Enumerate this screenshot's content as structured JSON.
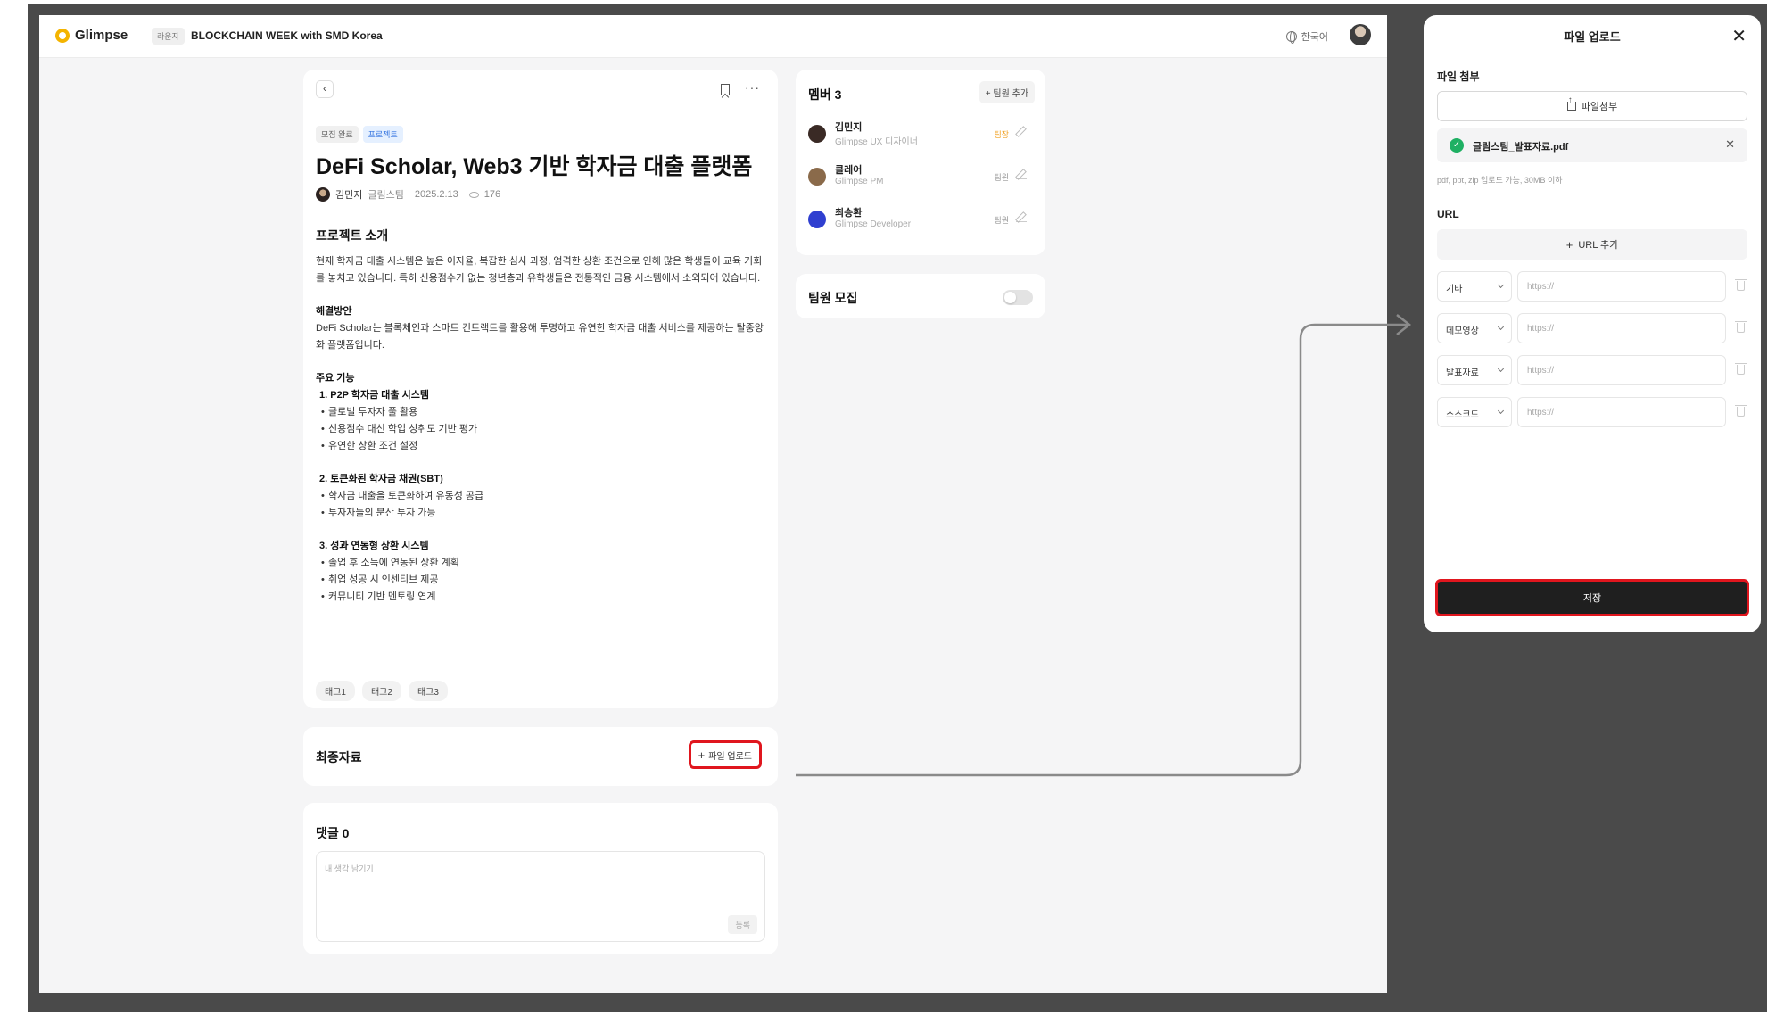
{
  "header": {
    "logo_text": "Glimpse",
    "chip": "라운지",
    "event_title": "BLOCKCHAIN WEEK with SMD Korea",
    "language": "한국어"
  },
  "project": {
    "badges": [
      "모집 완료",
      "프로젝트"
    ],
    "title": "DeFi Scholar, Web3 기반 학자금 대출 플랫폼",
    "author": "김민지",
    "team": "글림스팀",
    "date": "2025.2.13",
    "views": "176",
    "intro_heading": "프로젝트 소개",
    "intro_text": "현재 학자금 대출 시스템은 높은 이자율, 복잡한 심사 과정, 엄격한 상환 조건으로 인해 많은 학생들이 교육 기회를 놓치고 있습니다. 특히 신용점수가 없는 청년층과 유학생들은 전통적인 금융 시스템에서 소외되어 있습니다.",
    "solution_heading": "해결방안",
    "solution_text": "DeFi Scholar는 블록체인과 스마트 컨트랙트를 활용해 투명하고 유연한 학자금 대출 서비스를 제공하는 탈중앙화 플랫폼입니다.",
    "features_heading": "주요 기능",
    "features": [
      {
        "title": "1. P2P 학자금 대출 시스템",
        "items": [
          "글로벌 투자자 풀 활용",
          "신용점수 대신 학업 성취도 기반 평가",
          "유연한 상환 조건 설정"
        ]
      },
      {
        "title": "2. 토큰화된 학자금 채권(SBT)",
        "items": [
          "학자금 대출을 토큰화하여 유동성 공급",
          "투자자들의 분산 투자 가능"
        ]
      },
      {
        "title": "3. 성과 연동형 상환 시스템",
        "items": [
          "졸업 후 소득에 연동된 상환 계획",
          "취업 성공 시 인센티브 제공",
          "커뮤니티 기반 멘토링 연계"
        ]
      }
    ],
    "tags": [
      "태그1",
      "태그2",
      "태그3"
    ]
  },
  "final_materials": {
    "title": "최종자료",
    "upload_button": "파일 업로드"
  },
  "comments": {
    "title": "댓글 0",
    "placeholder": "내 생각 남기기",
    "submit": "등록"
  },
  "members": {
    "title": "멤버 3",
    "add_button": "팀원 추가",
    "list": [
      {
        "name": "김민지",
        "role": "Glimpse UX 디자이너",
        "badge": "팀장",
        "badge_color": "#f0a020",
        "avatar_color": "#3a2a25"
      },
      {
        "name": "클레어",
        "role": "Glimpse PM",
        "badge": "팀원",
        "badge_color": "#999999",
        "avatar_color": "#8a6a4a"
      },
      {
        "name": "최승환",
        "role": "Glimpse Developer",
        "badge": "팀원",
        "badge_color": "#999999",
        "avatar_color": "#2f3fd0"
      }
    ]
  },
  "recruit": {
    "title": "팀원 모집",
    "enabled": false
  },
  "modal": {
    "title": "파일 업로드",
    "attach_label": "파일 첨부",
    "attach_button": "파일첨부",
    "file_name": "글림스팀_발표자료.pdf",
    "hint": "pdf, ppt, zip 업로드 가능, 30MB 이하",
    "url_label": "URL",
    "url_add_button": "URL 추가",
    "url_rows": [
      {
        "type": "기타",
        "placeholder": "https://"
      },
      {
        "type": "데모영상",
        "placeholder": "https://"
      },
      {
        "type": "발표자료",
        "placeholder": "https://"
      },
      {
        "type": "소스코드",
        "placeholder": "https://"
      }
    ],
    "save_button": "저장"
  },
  "colors": {
    "highlight": "#e0161e",
    "accent_blue": "#3575e0",
    "success": "#1fb063",
    "frame": "#4a4a4a"
  }
}
